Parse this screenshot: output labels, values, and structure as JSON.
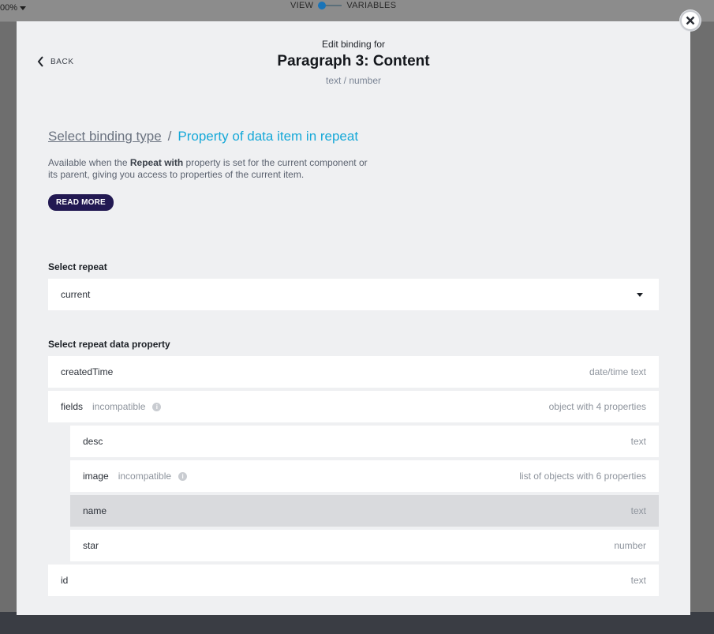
{
  "app": {
    "zoom_label": "00%",
    "view_label": "VIEW",
    "variables_label": "VARIABLES"
  },
  "modal": {
    "back_label": "BACK",
    "pre_title": "Edit binding for",
    "title": "Paragraph 3: Content",
    "subtitle": "text / number",
    "breadcrumb": {
      "link": "Select binding type",
      "separator": "/",
      "current": "Property of data item in repeat"
    },
    "description": {
      "part1": "Available when the ",
      "bold": "Repeat with",
      "part2": " property is set for the current component or its parent, giving you access to properties of the current item."
    },
    "read_more_label": "READ MORE",
    "select_repeat": {
      "label": "Select repeat",
      "value": "current"
    },
    "select_property_label": "Select repeat data property",
    "properties": [
      {
        "name": "createdTime",
        "incompatible": "",
        "type": "date/time text",
        "selected": false
      },
      {
        "name": "fields",
        "incompatible": "incompatible",
        "type": "object with 4 properties",
        "selected": false
      },
      {
        "name": "desc",
        "incompatible": "",
        "type": "text",
        "selected": false
      },
      {
        "name": "image",
        "incompatible": "incompatible",
        "type": "list of objects with 6 properties",
        "selected": false
      },
      {
        "name": "name",
        "incompatible": "",
        "type": "text",
        "selected": true
      },
      {
        "name": "star",
        "incompatible": "",
        "type": "number",
        "selected": false
      },
      {
        "name": "id",
        "incompatible": "",
        "type": "text",
        "selected": false
      }
    ],
    "colors": {
      "accent": "#15a8d8",
      "read_more_bg": "#221952",
      "selected_row": "#d9dadd"
    }
  }
}
